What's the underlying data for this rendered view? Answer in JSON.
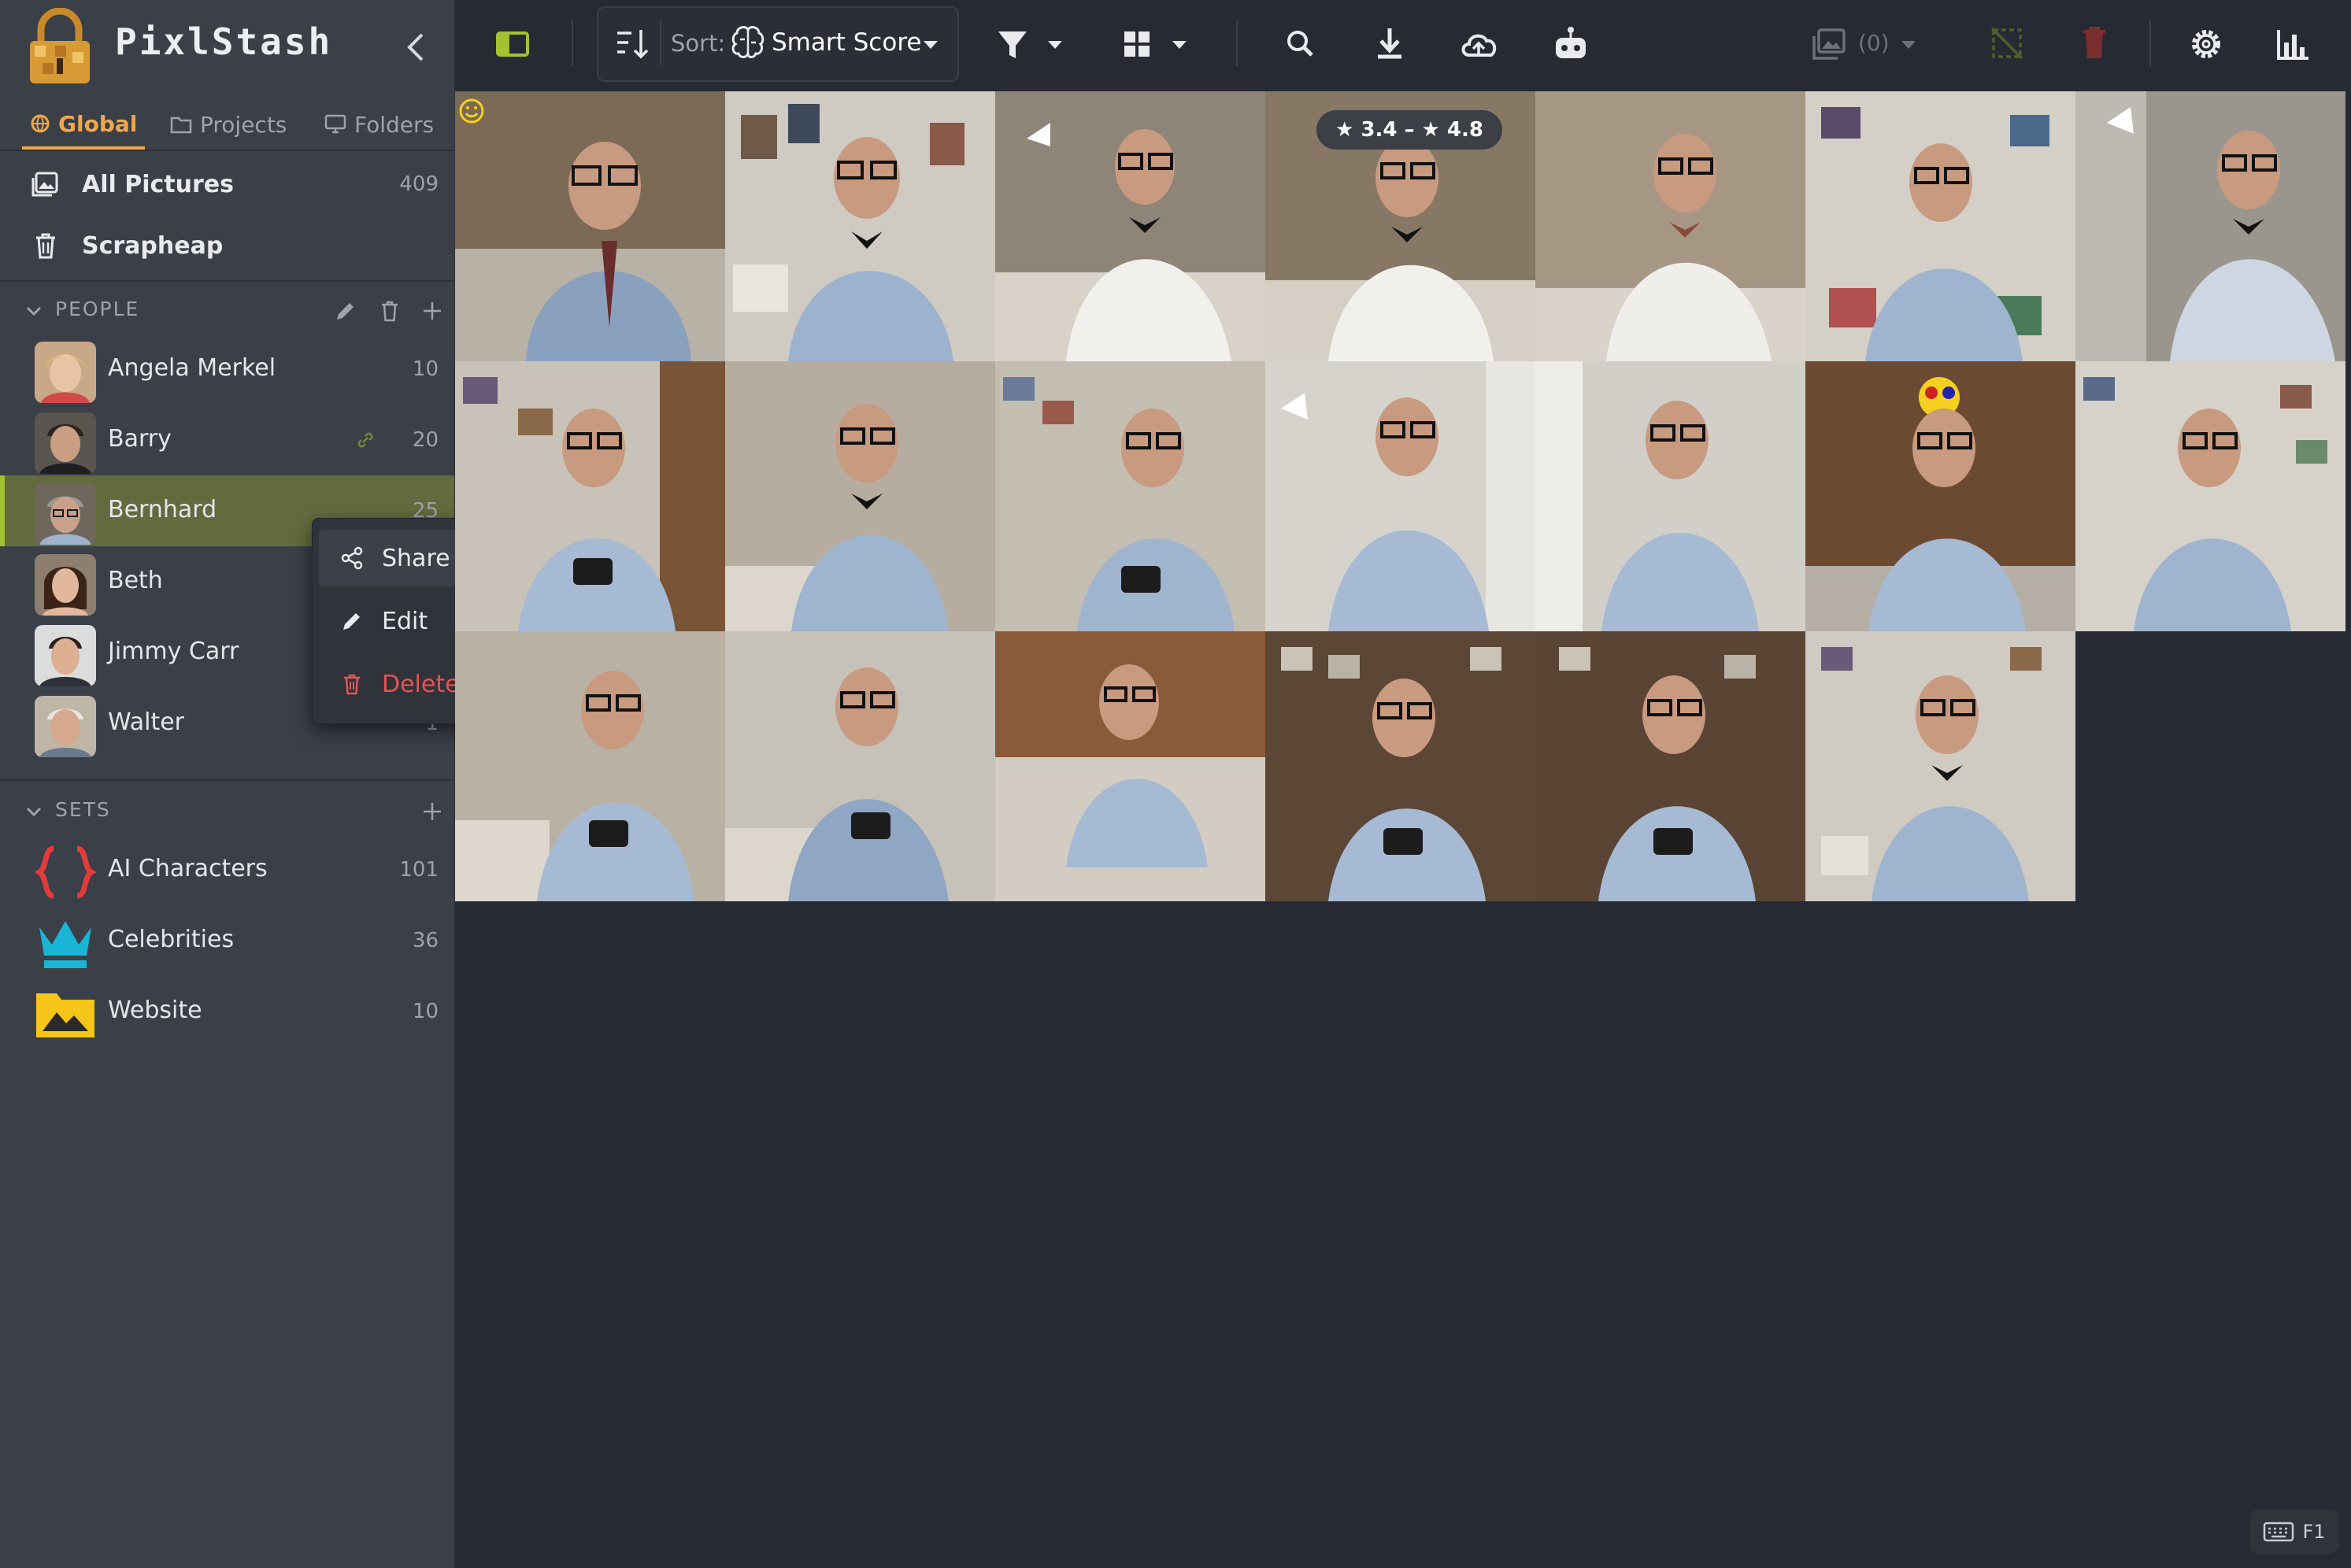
{
  "app": {
    "title": "PixlStash"
  },
  "scope_tabs": [
    {
      "label": "Global",
      "active": true
    },
    {
      "label": "Projects",
      "active": false
    },
    {
      "label": "Folders",
      "active": false
    }
  ],
  "nav": [
    {
      "label": "All Pictures",
      "count": "409",
      "icon": "images-icon"
    },
    {
      "label": "Scrapheap",
      "icon": "trash-icon"
    }
  ],
  "people_section": {
    "title": "PEOPLE"
  },
  "people": [
    {
      "label": "Angela Merkel",
      "count": "10"
    },
    {
      "label": "Barry",
      "count": "20"
    },
    {
      "label": "Bernhard",
      "count": "25",
      "active": true
    },
    {
      "label": "Beth"
    },
    {
      "label": "Jimmy Carr"
    },
    {
      "label": "Walter",
      "count": "1"
    }
  ],
  "sets_section": {
    "title": "SETS"
  },
  "sets": [
    {
      "label": "AI Characters",
      "count": "101",
      "icon": "braces-icon",
      "color": "#e23b3b"
    },
    {
      "label": "Celebrities",
      "count": "36",
      "icon": "crown-icon",
      "color": "#19b5d6"
    },
    {
      "label": "Website",
      "count": "10",
      "icon": "image-folder-icon",
      "color": "#f5c518"
    }
  ],
  "context_menu": {
    "items": [
      {
        "label": "Share",
        "icon": "share-icon"
      },
      {
        "label": "Edit",
        "icon": "pencil-icon"
      },
      {
        "label": "Delete",
        "icon": "trash-icon",
        "danger": true
      }
    ]
  },
  "toolbar": {
    "sort_label": "Sort:",
    "sort_value": "Smart Score",
    "selection_count": "(0)"
  },
  "grid": {
    "score_badge": "★ 3.4 – ★ 4.8",
    "rows": 3,
    "columns": 7,
    "thumbnail_count": 20
  },
  "keyboard_hint": {
    "label": "F1"
  },
  "colors": {
    "sidebar_bg": "#3b3f47",
    "main_bg": "#272a33",
    "active_tab": "#f0a64a",
    "active_row": "#636b3e",
    "accent_green": "#a3c132",
    "danger": "#e35555"
  }
}
